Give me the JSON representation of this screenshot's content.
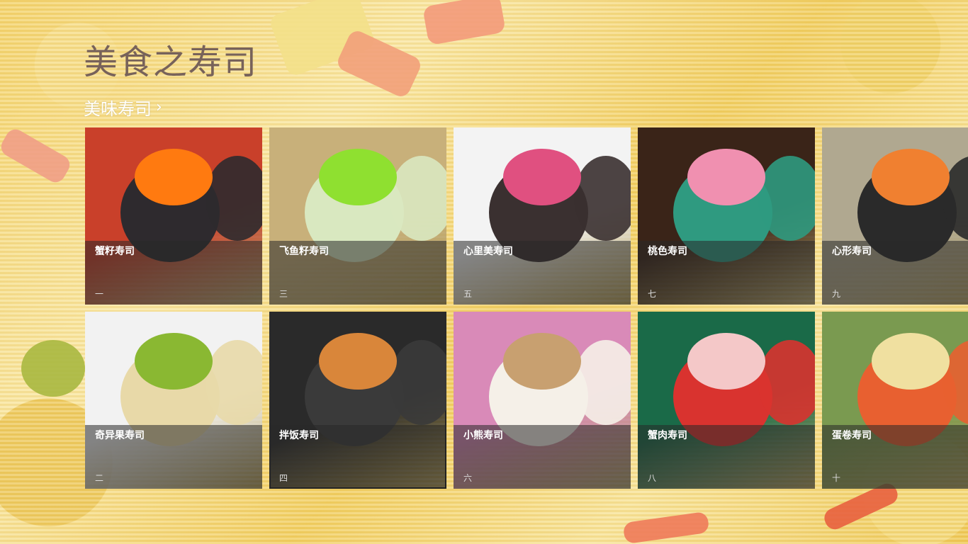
{
  "app": {
    "title": "美食之寿司"
  },
  "section": {
    "label": "美味寿司",
    "chevron_icon": "chevron-right-icon"
  },
  "tiles": [
    {
      "name": "蟹籽寿司",
      "number": "一",
      "bg": "#c9402a",
      "accent": "#ff7a10",
      "base": "#2e2a2e"
    },
    {
      "name": "奇异果寿司",
      "number": "二",
      "bg": "#f2f2f2",
      "accent": "#8ab832",
      "base": "#e8d9a8"
    },
    {
      "name": "飞鱼籽寿司",
      "number": "三",
      "bg": "#c8b07a",
      "accent": "#8fe030",
      "base": "#d9e8c0"
    },
    {
      "name": "拌饭寿司",
      "number": "四",
      "bg": "#2a2a2a",
      "accent": "#d9863a",
      "base": "#3a3a3a"
    },
    {
      "name": "心里美寿司",
      "number": "五",
      "bg": "#f3f3f3",
      "accent": "#e05080",
      "base": "#3a3030"
    },
    {
      "name": "小熊寿司",
      "number": "六",
      "bg": "#d98ab8",
      "accent": "#c8a070",
      "base": "#f5f0e8"
    },
    {
      "name": "桃色寿司",
      "number": "七",
      "bg": "#3a2418",
      "accent": "#f090b0",
      "base": "#2f9a80"
    },
    {
      "name": "蟹肉寿司",
      "number": "八",
      "bg": "#1a6a48",
      "accent": "#f4c8c8",
      "base": "#d9332f"
    },
    {
      "name": "心形寿司",
      "number": "九",
      "bg": "#b0a890",
      "accent": "#f08030",
      "base": "#2a2a2a"
    },
    {
      "name": "蛋卷寿司",
      "number": "十",
      "bg": "#7a9a50",
      "accent": "#f0e0a0",
      "base": "#e86030"
    }
  ]
}
